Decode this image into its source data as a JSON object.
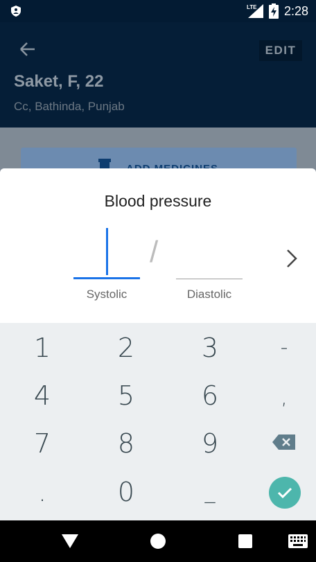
{
  "status_bar": {
    "network": "LTE",
    "time": "2:28"
  },
  "header": {
    "edit_label": "EDIT",
    "patient_name": "Saket, F, 22",
    "patient_location": "Cc, Bathinda, Punjab"
  },
  "background_action": {
    "label": "ADD MEDICINES"
  },
  "sheet": {
    "title": "Blood pressure",
    "separator": "/",
    "systolic_label": "Systolic",
    "diastolic_label": "Diastolic"
  },
  "keyboard": {
    "keys": [
      "1",
      "2",
      "3",
      "-",
      "4",
      "5",
      "6",
      ",",
      "7",
      "8",
      "9",
      ".",
      "0",
      "_"
    ]
  },
  "colors": {
    "accent": "#1a73e8",
    "done": "#4db6ac",
    "header": "#051e37"
  },
  "icons": {
    "back": "arrow-left-icon",
    "next": "chevron-right-icon",
    "backspace": "backspace-icon",
    "done": "check-icon"
  }
}
